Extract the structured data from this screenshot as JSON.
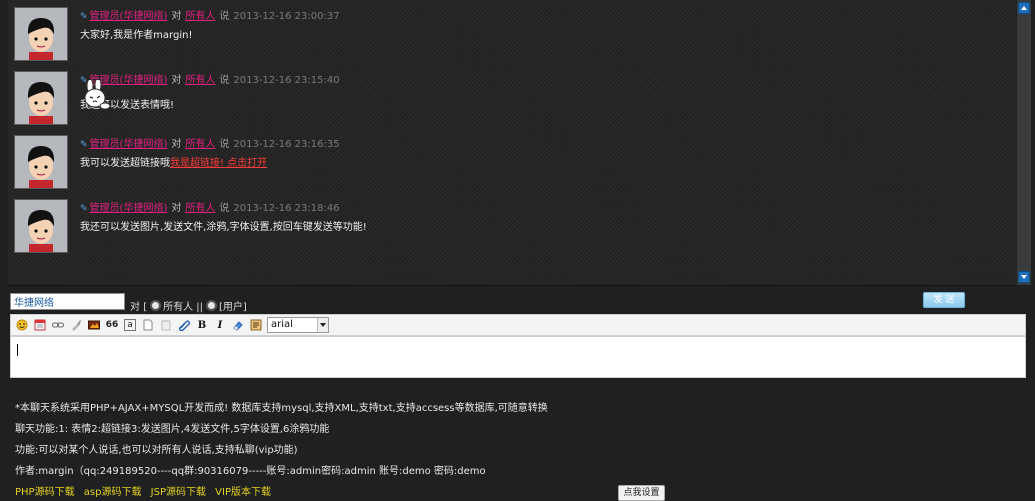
{
  "messages": [
    {
      "sender": "管理员(华捷网络)",
      "conj": "对",
      "target": "所有人",
      "said": "说",
      "time": "2013-12-16 23:00:37",
      "text": "大家好,我是作者margin!",
      "link": "",
      "emoticon": false
    },
    {
      "sender": "管理员(华捷网络)",
      "conj": "对",
      "target": "所有人",
      "said": "说",
      "time": "2013-12-16 23:15:40",
      "text": "我还可以发送表情哦!",
      "link": "",
      "emoticon": true
    },
    {
      "sender": "管理员(华捷网络)",
      "conj": "对",
      "target": "所有人",
      "said": "说",
      "time": "2013-12-16 23:16:35",
      "text": "我可以发送超链接哦",
      "link": "我是超链接! 点击打开",
      "emoticon": false
    },
    {
      "sender": "管理员(华捷网络)",
      "conj": "对",
      "target": "所有人",
      "said": "说",
      "time": "2013-12-16 23:18:46",
      "text": "我还可以发送图片,发送文件,涂鸦,字体设置,按回车键发送等功能!",
      "link": "",
      "emoticon": false
    }
  ],
  "compose": {
    "name_value": "华捷网络",
    "to_label": "对",
    "bracket_open": "[",
    "option_all": "所有人",
    "separator": "||",
    "option_user": "[用户]",
    "send_label": "发 送",
    "font_value": "arial"
  },
  "toolbar_icons": [
    "smiley-icon",
    "calendar-icon",
    "link-icon",
    "brush-icon",
    "image-icon",
    "quote-icon",
    "text-a-icon",
    "file-icon",
    "paste-icon",
    "attachment-icon",
    "bold-icon",
    "italic-icon",
    "eraser-icon",
    "scissors-icon"
  ],
  "toolbar_glyphs": {
    "quote": "66",
    "bold": "B",
    "italic": "I",
    "text_a": "a"
  },
  "info": [
    "*本聊天系统采用PHP+AJAX+MYSQL开发而成! 数据库支持mysql,支持XML,支持txt,支持accsess等数据库,可随意转换",
    "聊天功能:1: 表情2:超链接3:发送图片,4发送文件,5字体设置,6涂鸦功能",
    "功能:可以对某个人说话,也可以对所有人说话,支持私聊(vip功能)",
    "作者:margin（qq:249189520----qq群:90316079-----账号:admin密码:admin  账号:demo 密码:demo"
  ],
  "downloads": [
    "PHP源码下载",
    "asp源码下载",
    "JSP源码下载",
    "VIP版本下载"
  ],
  "settings_label": "点我设置",
  "colors": {
    "accent_pink": "#e0217c",
    "link_red": "#ff3b3b",
    "download_yellow": "#e6d21c",
    "send_blue": "#8ccaee",
    "scroll_blue": "#1f6fb8"
  }
}
